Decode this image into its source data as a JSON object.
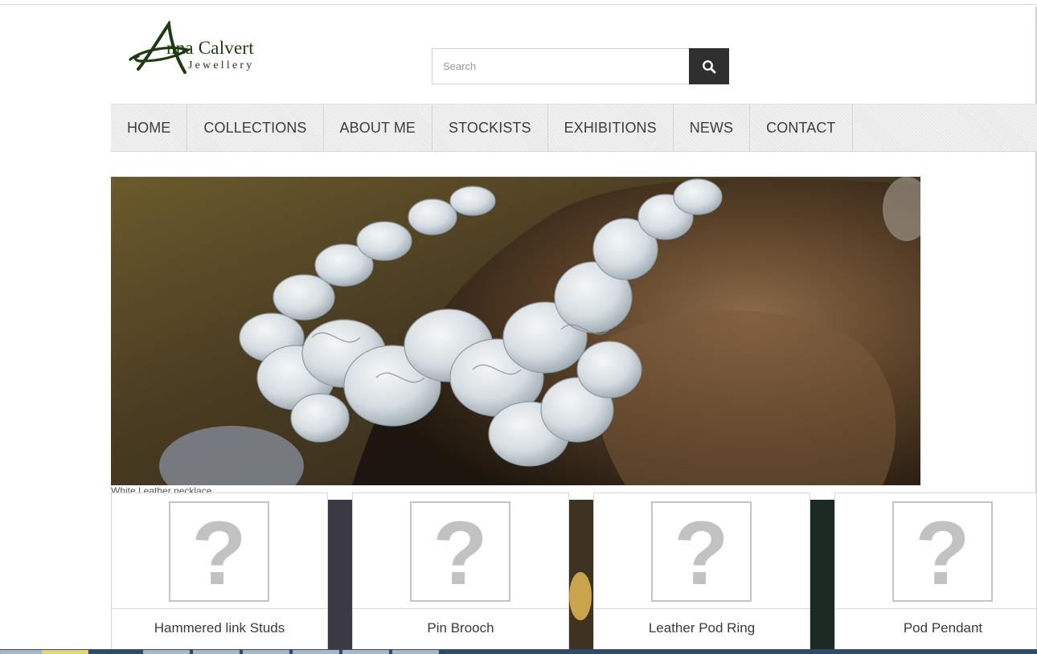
{
  "logo": {
    "line1": "nna Calvert",
    "line2": "Jewellery",
    "initial": "A",
    "color": "#1e3a10"
  },
  "search": {
    "placeholder": "Search",
    "value": "",
    "icon": "search-icon"
  },
  "nav": {
    "items": [
      {
        "label": "HOME"
      },
      {
        "label": "COLLECTIONS"
      },
      {
        "label": "ABOUT ME"
      },
      {
        "label": "STOCKISTS"
      },
      {
        "label": "EXHIBITIONS"
      },
      {
        "label": "NEWS"
      },
      {
        "label": "CONTACT"
      }
    ]
  },
  "hero": {
    "caption": "White Leather necklace",
    "image": "ruffled white leather necklace on stone"
  },
  "products": [
    {
      "title": "Hammered link Studs",
      "thumb": "?"
    },
    {
      "title": "Pin Brooch",
      "thumb": "?"
    },
    {
      "title": "Leather Pod Ring",
      "thumb": "?"
    },
    {
      "title": "Pod Pendant",
      "thumb": "?"
    }
  ],
  "colors": {
    "accent_dark": "#2f2f2f",
    "nav_bg": "#eeeeee",
    "placeholder": "#c2c2c2"
  }
}
